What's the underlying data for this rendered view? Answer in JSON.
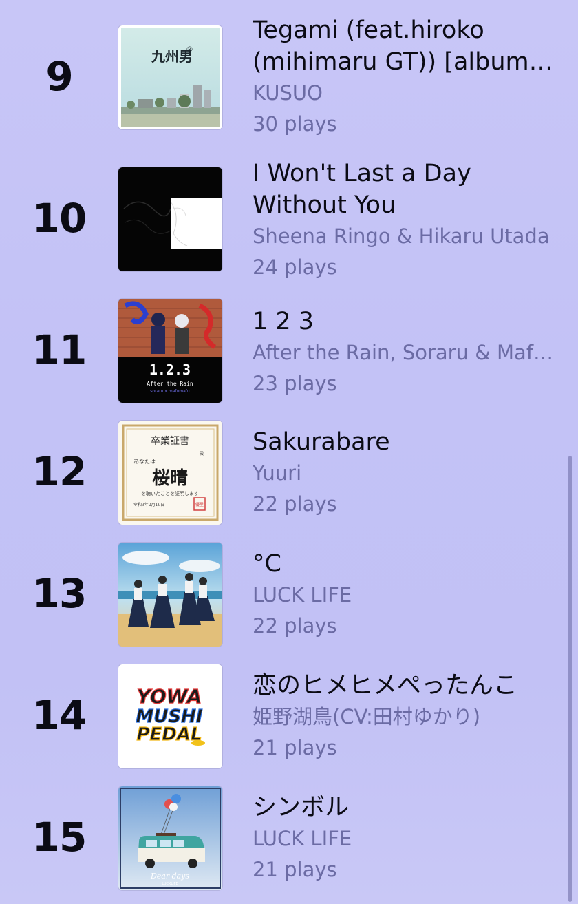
{
  "tracks": [
    {
      "rank": "9",
      "title": "Tegami (feat.hiroko (mihimaru GT)) [album version]",
      "artist": "KUSUO",
      "plays": "30 plays",
      "art_icon": "kyushu-otoko-album-art"
    },
    {
      "rank": "10",
      "title": "I Won't Last a Day Without You",
      "artist": "Sheena Ringo & Hikaru Utada",
      "plays": "24 plays",
      "art_icon": "black-white-album-art"
    },
    {
      "rank": "11",
      "title": "1 2 3",
      "artist": "After the Rain, Soraru & Mafumafu",
      "plays": "23 plays",
      "art_icon": "after-the-rain-123-album-art"
    },
    {
      "rank": "12",
      "title": "Sakurabare",
      "artist": "Yuuri",
      "plays": "22 plays",
      "art_icon": "certificate-album-art"
    },
    {
      "rank": "13",
      "title": "°C",
      "artist": "LUCK LIFE",
      "plays": "22 plays",
      "art_icon": "beach-students-album-art"
    },
    {
      "rank": "14",
      "title": "恋のヒメヒメぺったんこ",
      "artist": "姫野湖鳥(CV:田村ゆかり)",
      "plays": "21 plays",
      "art_icon": "yowamushi-pedal-album-art"
    },
    {
      "rank": "15",
      "title": "シンボル",
      "artist": "LUCK LIFE",
      "plays": "21 plays",
      "art_icon": "dear-days-van-album-art"
    }
  ],
  "art_text": {
    "kyushu": "九州男",
    "kyushu_mark": "®",
    "after_rain_title": "1.2.3",
    "after_rain_sub": "After the Rain",
    "after_rain_names": "soraru x mafumafu",
    "cert_heading": "卒業証書",
    "cert_num": "殿",
    "cert_to": "あなたは",
    "cert_big": "桜晴",
    "cert_line": "を聴いたことを証明します",
    "cert_date": "令和3年2月19日",
    "cert_seal": "優里",
    "ywp_1": "YOWA",
    "ywp_2": "MUSHI",
    "ywp_3": "PEDAL",
    "dear_days": "Dear days",
    "dear_days_sub": "LUCKLIFE"
  },
  "colors": {
    "background": "#c4c3f6",
    "rank_text": "#0b0b14",
    "secondary_text": "#6b6ba4"
  }
}
